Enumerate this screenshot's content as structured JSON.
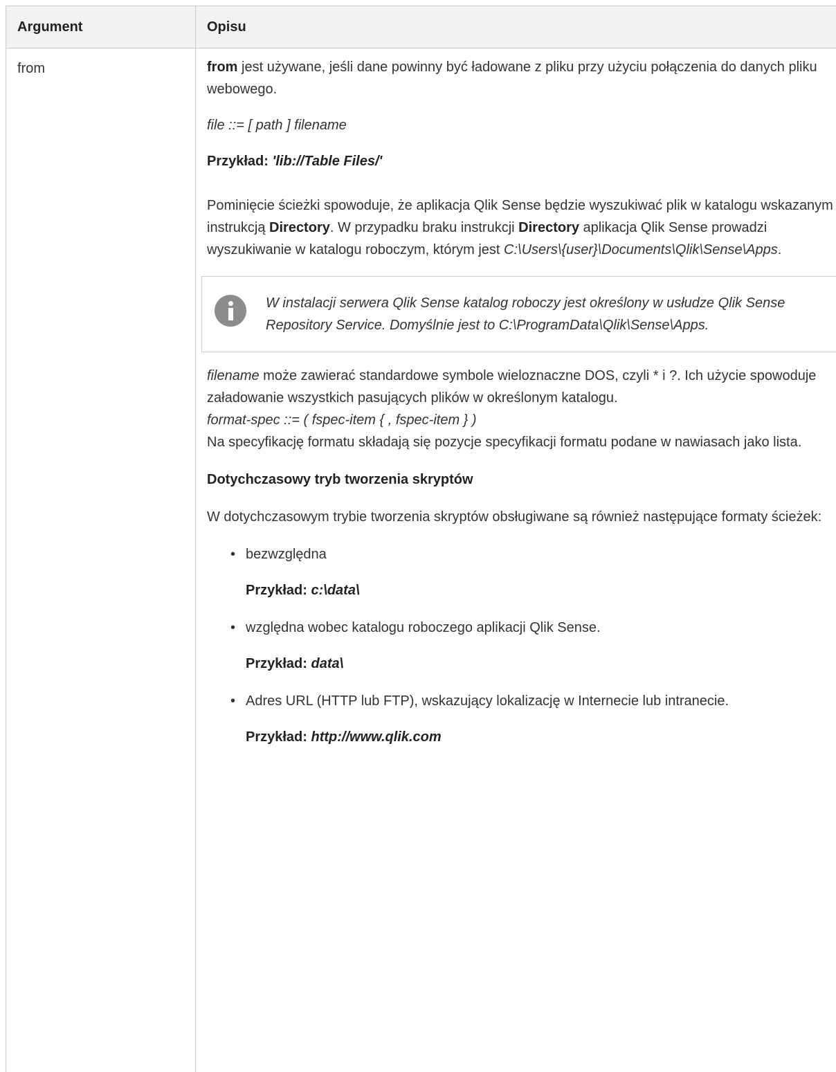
{
  "table": {
    "header": {
      "argument": "Argument",
      "description": "Opisu"
    },
    "row": {
      "argument": "from",
      "p1_bold": "from",
      "p1_rest": " jest używane, jeśli dane powinny być ładowane z pliku przy użyciu połączenia do danych pliku webowego.",
      "file_syntax": "file ::= [ path ] filename",
      "example1_label": "Przykład: ",
      "example1_value": "'lib://Table Files/'",
      "p2_a": "Pominięcie ścieżki spowoduje, że aplikacja Qlik Sense będzie wyszukiwać plik w katalogu wskazanym instrukcją ",
      "p2_b": "Directory",
      "p2_c": ". W przypadku braku instrukcji ",
      "p2_d": "Directory",
      "p2_e": " aplikacja Qlik Sense prowadzi wyszukiwanie w katalogu roboczym, którym jest ",
      "p2_path": "C:\\Users\\{user}\\Documents\\Qlik\\Sense\\Apps",
      "p2_end": ".",
      "note_text": "W instalacji serwera Qlik Sense katalog roboczy jest określony w usłudze Qlik Sense Repository Service. Domyślnie jest to C:\\ProgramData\\Qlik\\Sense\\Apps.",
      "p3_italic": "filename",
      "p3_rest": " może zawierać standardowe symbole wieloznaczne DOS, czyli * i ?. Ich użycie spowoduje załadowanie wszystkich pasujących plików w określonym katalogu.",
      "format_spec": "format-spec ::= ( fspec-item { , fspec-item } )",
      "p4": "Na specyfikację formatu składają się pozycje specyfikacji formatu podane w nawiasach jako lista.",
      "legacy_heading": "Dotychczasowy tryb tworzenia skryptów",
      "legacy_intro": "W dotychczasowym trybie tworzenia skryptów obsługiwane są również następujące formaty ścieżek:",
      "items": [
        {
          "text": "bezwzględna",
          "example_label": "Przykład: ",
          "example_value": "c:\\data\\"
        },
        {
          "text": "względna wobec katalogu roboczego aplikacji Qlik Sense.",
          "example_label": "Przykład: ",
          "example_value": "data\\"
        },
        {
          "text": "Adres URL (HTTP lub FTP), wskazujący lokalizację w Internecie lub intranecie.",
          "example_label": "Przykład: ",
          "example_value": "http://www.qlik.com"
        }
      ]
    }
  }
}
